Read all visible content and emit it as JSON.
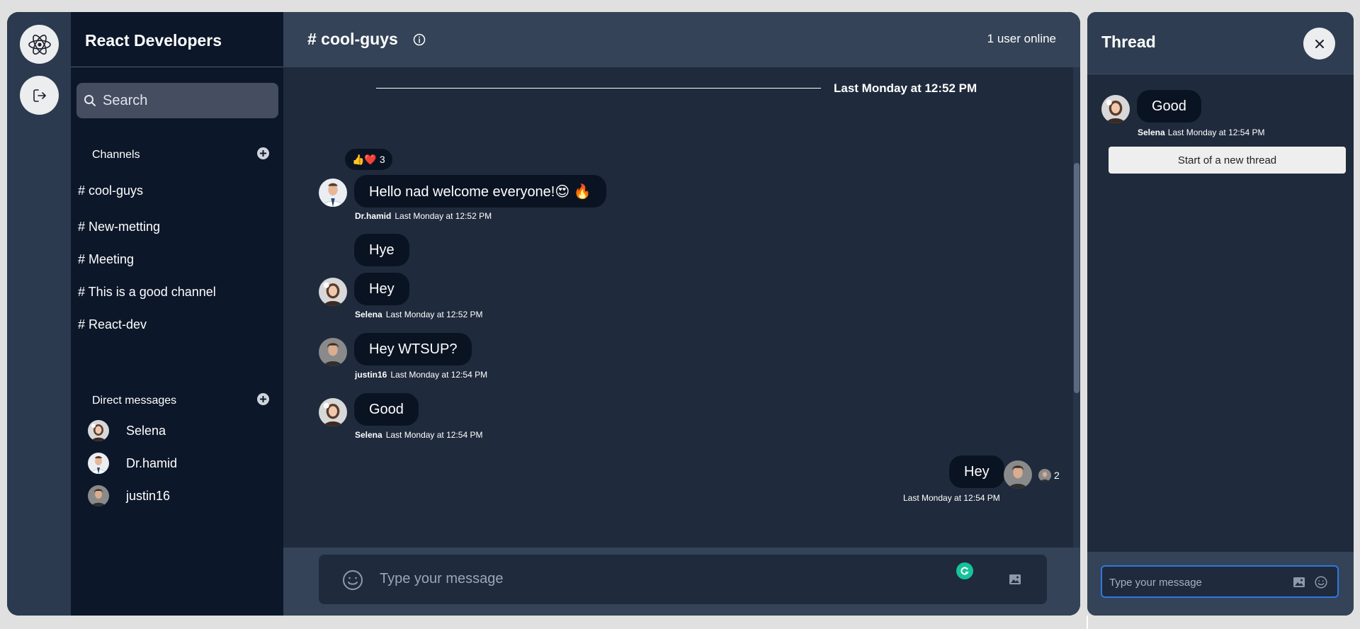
{
  "team": {
    "name": "React Developers"
  },
  "search": {
    "placeholder": "Search"
  },
  "sidebar": {
    "channels_label": "Channels",
    "channels": [
      {
        "label": "# cool-guys"
      },
      {
        "label": "# New-metting"
      },
      {
        "label": "# Meeting"
      },
      {
        "label": "# This is a good channel"
      },
      {
        "label": "# React-dev"
      }
    ],
    "dms_label": "Direct messages",
    "dms": [
      {
        "name": "Selena",
        "avatar": "selena-avatar"
      },
      {
        "name": "Dr.hamid",
        "avatar": "drhamid-avatar"
      },
      {
        "name": "justin16",
        "avatar": "justin16-avatar"
      }
    ]
  },
  "channel": {
    "title": "# cool-guys",
    "online": "1 user online",
    "date_separator": "Last Monday at 12:52 PM"
  },
  "messages": [
    {
      "text": "Hello nad welcome everyone!😍 🔥",
      "user": "Dr.hamid",
      "time": "Last Monday at 12:52 PM",
      "reactions": "👍❤️",
      "reaction_count": "3"
    },
    {
      "text": "Hye"
    },
    {
      "text": "Hey",
      "user": "Selena",
      "time": "Last Monday at 12:52 PM"
    },
    {
      "text": "Hey WTSUP?",
      "user": "justin16",
      "time": "Last Monday at 12:54 PM"
    },
    {
      "text": "Good",
      "user": "Selena",
      "time": "Last Monday at 12:54 PM"
    },
    {
      "text": "Hey",
      "time": "Last Monday at 12:54 PM",
      "reply_count": "2"
    }
  ],
  "composer": {
    "placeholder": "Type your message"
  },
  "thread": {
    "title": "Thread",
    "message": "Good",
    "user": "Selena",
    "time": "Last Monday at 12:54 PM",
    "start_label": "Start of a new thread",
    "placeholder": "Type your message"
  },
  "colors": {
    "rail": "#2c3a4f",
    "sidebar": "#0c1729",
    "main": "#1f2a3c",
    "header": "#344357",
    "bubble": "#0a1322",
    "accent": "#2f78e0"
  }
}
